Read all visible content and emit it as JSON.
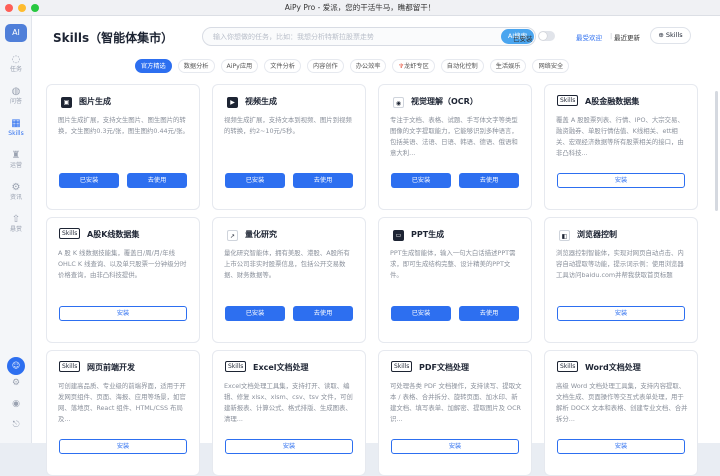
{
  "window": {
    "title": "AiPy Pro - 爱派，您的干活牛马，瞧都留干！"
  },
  "sidebar": {
    "logo_label": "AI",
    "items": [
      {
        "icon": "chat-icon",
        "label": "任务"
      },
      {
        "icon": "question-icon",
        "label": "问答"
      },
      {
        "icon": "skills-icon",
        "label": "Skills"
      },
      {
        "icon": "trophy-icon",
        "label": "运营"
      },
      {
        "icon": "gear-icon",
        "label": "资讯"
      },
      {
        "icon": "upload-icon",
        "label": "悬赏"
      }
    ]
  },
  "header": {
    "page_title": "Skills（智能体集市）",
    "search_placeholder": "输入你想做的任务，比如：我想分析特斯拉股票走势",
    "search_button": "AI搜索",
    "installed_label": "已安装",
    "sort_popular": "最受欢迎",
    "sort_sep": "|",
    "sort_recent": "最近更新",
    "skills_button": "Skills"
  },
  "tabs": [
    "官方精选",
    "数据分析",
    "AiPy应用",
    "文件分析",
    "内容创作",
    "办公效率",
    "龙虾专区",
    "自动化控制",
    "生活娱乐",
    "网络安全"
  ],
  "labels": {
    "installed": "已安装",
    "use": "去使用",
    "install": "安装",
    "tag": "Skills"
  },
  "colors": {
    "accent": "#2d6ff0",
    "search_button": "#4aa5ef"
  },
  "cards": [
    {
      "name": "图片生成",
      "icon": "image-icon",
      "desc": "图片生成扩展，支持文生图片、图生图片的转换，文生图约0.3元/张，图生图约0.44元/张。",
      "state": "installed"
    },
    {
      "name": "视频生成",
      "icon": "video-icon",
      "desc": "视频生成扩展，支持文本到视频、图片到视频的转换，约2~10元/5秒。",
      "state": "installed"
    },
    {
      "name": "视觉理解（OCR）",
      "icon": "eye-icon",
      "desc": "专注于文档、表格、试题、手写体文字等类型图像的文字提取能力，它能够识别多种语言，包括英语、法语、日语、韩语、德语、俄语和意大利...",
      "state": "installed"
    },
    {
      "name": "A股金融数据集",
      "icon": "skills-tag",
      "desc": "覆盖 A 股股票列表、行情、IPO、大宗交易、融资融券、单股行情估值、K线相关、ett相关、宏观经济数据等所有股票相关的接口，由非凸科技...",
      "state": "install"
    },
    {
      "name": "A股K线数据集",
      "icon": "skills-tag",
      "desc": "A 股 K 线数据技能集，覆盖日/周/月/年线 OHLC K 线查询、以及单只股票一分钟级分时价格查询，由非凸科技提供。",
      "state": "install"
    },
    {
      "name": "量化研究",
      "icon": "chart-icon",
      "desc": "量化研究智能体，拥有美股、港股、A股所有上市公司非实时股票信息，包括公开交易数据、财务数据等。",
      "state": "installed"
    },
    {
      "name": "PPT生成",
      "icon": "ppt-icon",
      "desc": "PPT生成智能体，输入一句大白话描述PPT需求，即可生成结构完整、设计精美的PPT文件。",
      "state": "installed"
    },
    {
      "name": "浏览器控制",
      "icon": "browser-icon",
      "desc": "浏览器控制智能体，实现对网页自动点击、内容自动提取等功能，提示词示例：使用浏览器工具访问baidu.com并帮我获取首页标题",
      "state": "install"
    },
    {
      "name": "网页前端开发",
      "icon": "skills-tag",
      "desc": "可创建高品质、专业级的前端界面，适用于开发网页组件、页面、海报、应用等场景，如官网、落地页、React 组件、HTML/CSS 布局及...",
      "state": "install"
    },
    {
      "name": "Excel文档处理",
      "icon": "skills-tag",
      "desc": "Excel文档处理工具集，支持打开、读取、编辑、修复 xlsx、xlsm、csv、tsv 文件，可创建新报表、计算公式、格式排版、生成图表、清理...",
      "state": "install"
    },
    {
      "name": "PDF文档处理",
      "icon": "skills-tag",
      "desc": "可处理各类 PDF 文档操作，支持读写、提取文本 / 表格、合并拆分、旋转页面、加水印、新建文档、填写表单、加解密、提取图片及 OCR 识...",
      "state": "install"
    },
    {
      "name": "Word文档处理",
      "icon": "skills-tag",
      "desc": "高级 Word 文档处理工具集，支持内容提取、文档生成、页面操作等交互式表单处理，用于解析 DOCX 文本和表格、创建专业文档、合并拆分...",
      "state": "install"
    }
  ]
}
